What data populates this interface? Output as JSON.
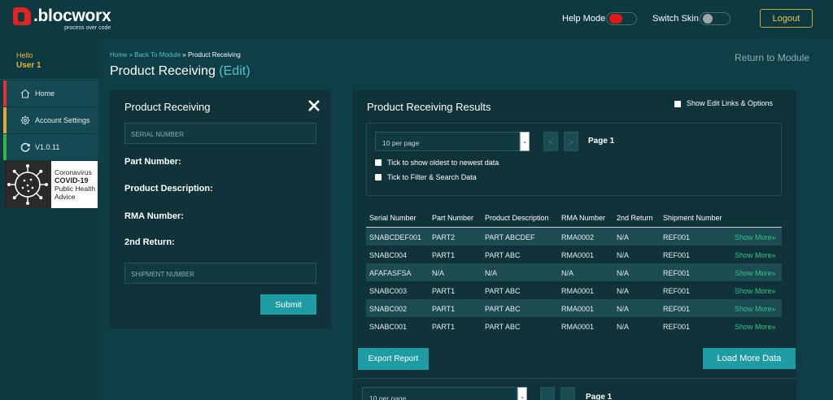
{
  "brand": {
    "name": ".blocworx",
    "tagline": "process over code"
  },
  "header": {
    "help_mode_label": "Help Mode",
    "switch_skin_label": "Switch Skin",
    "logout_label": "Logout",
    "help_mode_on": true,
    "switch_skin_on": false
  },
  "sidebar": {
    "hello": "Hello",
    "user": "User 1",
    "items": [
      {
        "label": "Home",
        "icon": "home-icon",
        "accent": "#e0303a"
      },
      {
        "label": "Account Settings",
        "icon": "gear-icon",
        "accent": "#e8a23a"
      },
      {
        "label": "V1.0.11",
        "icon": "refresh-icon",
        "accent": "#3ab54a"
      }
    ],
    "covid": {
      "line1": "Coronavirus",
      "line2": "COVID-19",
      "line3": "Public Health",
      "line4": "Advice"
    }
  },
  "breadcrumb": {
    "home": "Home",
    "sep1": " » ",
    "back": "Back To Module",
    "sep2": " » ",
    "current": "Product Receiving"
  },
  "page": {
    "title": "Product Receiving",
    "edit": "(Edit)",
    "return_link": "Return to Module"
  },
  "form": {
    "title": "Product Receiving",
    "serial_placeholder": "SERIAL NUMBER",
    "labels": [
      "Part Number:",
      "Product Description:",
      "RMA Number:",
      "2nd Return:"
    ],
    "shipment_placeholder": "SHIPMENT NUMBER",
    "submit_label": "Submit"
  },
  "results": {
    "title": "Product Receiving Results",
    "show_edit_links": "Show Edit Links & Options",
    "per_page": "10 per page",
    "prev": "<",
    "next": ">",
    "page_label": "Page 1",
    "tick_oldest": "Tick to show oldest to newest data",
    "tick_filter": "Tick to Filter & Search Data",
    "columns": [
      "Serial Number",
      "Part Number",
      "Product Description",
      "RMA Number",
      "2nd Return",
      "Shipment Number"
    ],
    "rows": [
      [
        "SNABCDEF001",
        "PART2",
        "PART ABCDEF",
        "RMA0002",
        "N/A",
        "REF001",
        "Show More»"
      ],
      [
        "SNABC004",
        "PART1",
        "PART ABC",
        "RMA0001",
        "N/A",
        "REF001",
        "Show More»"
      ],
      [
        "AFAFASFSA",
        "N/A",
        "N/A",
        "N/A",
        "N/A",
        "REF001",
        "Show More»"
      ],
      [
        "SNABC003",
        "PART1",
        "PART ABC",
        "RMA0001",
        "N/A",
        "REF001",
        "Show More»"
      ],
      [
        "SNABC002",
        "PART1",
        "PART ABC",
        "RMA0001",
        "N/A",
        "REF001",
        "Show More»"
      ],
      [
        "SNABC001",
        "PART1",
        "PART ABC",
        "RMA0001",
        "N/A",
        "REF001",
        "Show More»"
      ]
    ],
    "export_label": "Export Report",
    "load_more_label": "Load More Data",
    "bottom_per_page": "10 per page",
    "bottom_page_label": "Page 1"
  },
  "colors": {
    "accent": "#1d9ca4",
    "link": "#4fc3cf",
    "show_more": "#2fc48b",
    "user": "#e8b63a"
  }
}
